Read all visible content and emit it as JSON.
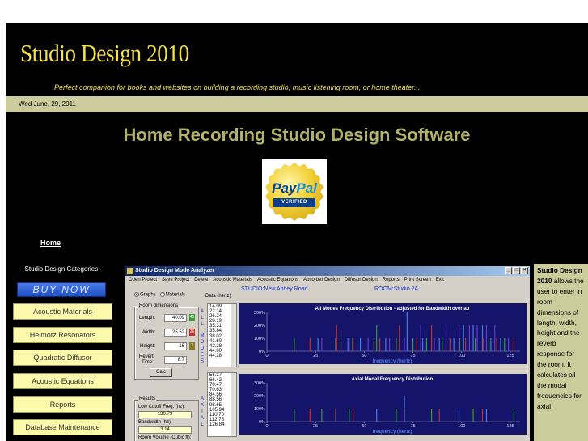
{
  "site": {
    "title": "Studio Design 2010",
    "tagline": "Perfect companion for books and websites on building a recording studio, music listening room, or home theater...",
    "date": "Wed June, 29, 2011",
    "heading": "Home Recording Studio Design Software"
  },
  "paypal": {
    "brand_pay": "Pay",
    "brand_pal": "Pal",
    "verified": "VERIFIED"
  },
  "nav": {
    "home": "Home",
    "categories_label": "Studio Design Categories:",
    "buy_now": "BUY NOW",
    "items": [
      "Acoustic Materials",
      "Helmotz Resonators",
      "Quadratic Diffusor",
      "Acoustic Equations",
      "Reports",
      "Database Maintenance"
    ]
  },
  "app": {
    "window_title": "Studio Design Mode Analyzer",
    "window_buttons": [
      "_",
      "□",
      "×"
    ],
    "menu": [
      "Open Project",
      "Save Project",
      "Delete",
      "Acoustic Materials",
      "Acoustic Equations",
      "Absorber Design",
      "Diffusor Design",
      "Reports",
      "Print Screen",
      "Exit"
    ],
    "view_graphs": "Graphs",
    "view_materials": "Materials",
    "room_dimensions_label": "Room dimensions",
    "length_label": "Length:",
    "length": "40.09",
    "width_label": "Width:",
    "width": "25.52",
    "height_label": "Height:",
    "height": "16",
    "reverb_label": "Reverb",
    "time_label": "Time:",
    "reverb": "8.7",
    "spin_length": "43",
    "spin_width": "26",
    "spin_height": "3",
    "calc": "Calc",
    "results_label": "Results",
    "low_cutoff_label": "Low Cutoff Freq. (hz):",
    "low_cutoff": "130.79",
    "bandwidth_label": "Bandwidth (hz):",
    "bandwidth": "3.14",
    "room_volume_label": "Room Volume (Cubic ft):",
    "vertical_all_modes": [
      "A",
      "L",
      "L",
      "",
      "M",
      "O",
      "D",
      "E",
      "S"
    ],
    "vertical_axial": [
      "A",
      "X",
      "I",
      "A",
      "L"
    ],
    "data_label": "Data (hertz)",
    "all_modes_data": [
      "14.09",
      "22.14",
      "26.24",
      "28.19",
      "35.31",
      "35.84",
      "38.02",
      "41.60",
      "42.28",
      "44.00",
      "44.28"
    ],
    "axial_data": [
      "56.37",
      "66.42",
      "70.47",
      "70.63",
      "84.56",
      "88.56",
      "98.65",
      "105.94",
      "110.70",
      "112.75",
      "126.84"
    ],
    "studio_label": "STUDIO:",
    "studio_name": "New Abbey Road",
    "room_label": "ROOM:",
    "room_name": "Studio 2A"
  },
  "chart_data": [
    {
      "type": "bar",
      "title": "All Modes Frequency Distribution - adjusted for Bandwidth overlap",
      "xlabel": "frequency (hertz)",
      "ylabel": "",
      "xlim": [
        0,
        130
      ],
      "ylim": [
        0,
        300
      ],
      "yticks": [
        "300%",
        "200%",
        "100%",
        "0%"
      ],
      "xticks": [
        "0",
        "25",
        "50",
        "75",
        "100",
        "125"
      ],
      "x": [
        14.09,
        22.14,
        26.24,
        28.19,
        35.31,
        35.84,
        38.02,
        41.6,
        42.28,
        44,
        44.28,
        48,
        52,
        55,
        56.37,
        58,
        61,
        63,
        66.42,
        68,
        70.47,
        70.63,
        72,
        75,
        77,
        79,
        80,
        82,
        84.56,
        86,
        88.56,
        90,
        92,
        94,
        96,
        98.65,
        99,
        101,
        102,
        104,
        105.94,
        107,
        108,
        110.7,
        111,
        112.75,
        114,
        115,
        117,
        118,
        120,
        122,
        124,
        126.84
      ],
      "values": [
        100,
        100,
        100,
        100,
        100,
        200,
        100,
        100,
        100,
        100,
        100,
        100,
        100,
        100,
        200,
        100,
        100,
        100,
        100,
        200,
        100,
        100,
        300,
        100,
        100,
        200,
        100,
        100,
        200,
        100,
        100,
        100,
        200,
        100,
        100,
        200,
        100,
        200,
        100,
        200,
        200,
        100,
        200,
        200,
        100,
        200,
        100,
        100,
        200,
        100,
        100,
        100,
        100,
        100
      ],
      "colors": [
        "#3a9a3a",
        "#c03030",
        "#4a7ae0",
        "#6a3ad0",
        "#3a9a3a",
        "#c03030",
        "#8a8a8a",
        "#4a7ae0",
        "#6a3ad0",
        "#3a9a3a",
        "#c03030",
        "#4a7ae0",
        "#6a3ad0",
        "#8a8a8a",
        "#3a9a3a",
        "#c03030",
        "#4a7ae0",
        "#6a3ad0",
        "#3a9a3a",
        "#c03030",
        "#4a7ae0",
        "#6a3ad0",
        "#4a7ae0",
        "#3a9a3a",
        "#c03030",
        "#6a3ad0",
        "#4a7ae0",
        "#3a9a3a",
        "#c03030",
        "#6a3ad0",
        "#4a7ae0",
        "#3a9a3a",
        "#6a3ad0",
        "#c03030",
        "#4a7ae0",
        "#6a3ad0",
        "#3a9a3a",
        "#4a7ae0",
        "#c03030",
        "#6a3ad0",
        "#4a7ae0",
        "#3a9a3a",
        "#6a3ad0",
        "#4a7ae0",
        "#c03030",
        "#6a3ad0",
        "#3a9a3a",
        "#4a7ae0",
        "#6a3ad0",
        "#c03030",
        "#4a7ae0",
        "#3a9a3a",
        "#6a3ad0",
        "#c03030"
      ]
    },
    {
      "type": "bar",
      "title": "Axial Modal Frequency Distribution",
      "xlabel": "frequency (hertz)",
      "ylabel": "",
      "xlim": [
        0,
        130
      ],
      "ylim": [
        0,
        300
      ],
      "yticks": [
        "300%",
        "200%",
        "100%",
        "0%"
      ],
      "xticks": [
        "0",
        "25",
        "50",
        "75",
        "100",
        "125"
      ],
      "x": [
        14.09,
        22.14,
        28.19,
        35.31,
        42.28,
        44.28,
        56.37,
        66.42,
        70.47,
        70.63,
        84.56,
        88.56,
        98.65,
        105.94,
        110.7,
        112.75,
        126.84
      ],
      "values": [
        100,
        100,
        100,
        100,
        100,
        100,
        100,
        100,
        100,
        200,
        100,
        100,
        100,
        100,
        100,
        100,
        100
      ],
      "colors": [
        "#3a9a3a",
        "#c03030",
        "#3a9a3a",
        "#c03030",
        "#3a9a3a",
        "#c03030",
        "#4a7ae0",
        "#3a9a3a",
        "#c03030",
        "#4a7ae0",
        "#3a9a3a",
        "#c03030",
        "#4a7ae0",
        "#3a9a3a",
        "#c03030",
        "#4a7ae0",
        "#3a9a3a"
      ]
    }
  ],
  "sidebar": {
    "title": "Studio Design 2010",
    "text": "allows the user to enter in room dimensions of length, width, height and the reverb response for the room. It calculates all the modal frequencies for axial,"
  },
  "colors": {
    "accent_yellow": "#f3e24a",
    "heading_olive": "#b2b26e",
    "date_bar": "#cbcb9c",
    "nav_button": "#fdfbab",
    "chart_bg": "#14146a"
  }
}
